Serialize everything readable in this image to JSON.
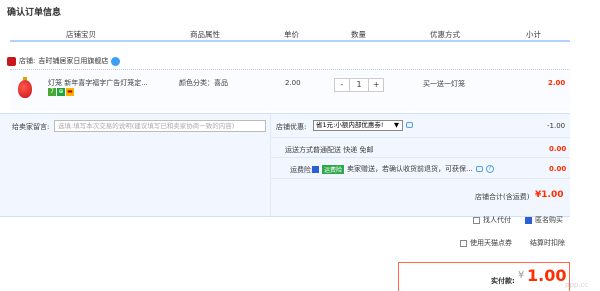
{
  "page_title": "确认订单信息",
  "columns": [
    "店铺宝贝",
    "商品属性",
    "单价",
    "数量",
    "优惠方式",
    "小计"
  ],
  "shop": {
    "label": "店铺:",
    "name": "吉时铺居家日用旗舰店"
  },
  "item": {
    "name": "灯笼 新年喜字福字广告灯笼定...",
    "attr": "颜色分类：喜品",
    "badges": [
      "7",
      "⊕",
      "▬"
    ],
    "unit_price": "2.00",
    "quantity": "1",
    "qty_minus": "-",
    "qty_plus": "+",
    "promo": "买一送一灯笼",
    "subtotal": "2.00"
  },
  "message": {
    "label": "给卖家留言:",
    "placeholder": "选填:填写本次交易的说明(建议填写已和卖家协商一致的内容)"
  },
  "shop_discount": {
    "label": "店铺优惠:",
    "selected": "省1元:小额内部优惠劵!",
    "caret": "▼",
    "amount": "-1.00"
  },
  "shipping": {
    "label": "运送方式:",
    "text": "普通配送 快递 免邮",
    "amount": "0.00"
  },
  "insurance": {
    "label": "运费险:",
    "tag": "运费险",
    "text": "卖家赠送，若确认收货前退货，可获保...",
    "help": "?",
    "amount": "0.00"
  },
  "shop_total": {
    "label": "店铺合计(含运费)",
    "amount": "¥1.00"
  },
  "options": {
    "substitute_pay": "找人代付",
    "anonymous": "匿名购买"
  },
  "tmall": {
    "points": "使用天猫点券",
    "deduct": "结算时扣除"
  },
  "final": {
    "label": "实付款:",
    "currency": "¥",
    "amount": "1.00",
    "watermark": "ppp.cc"
  }
}
